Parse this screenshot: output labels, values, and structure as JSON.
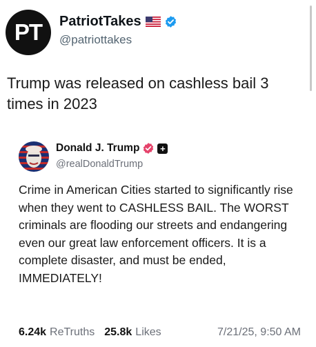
{
  "post": {
    "avatar_text": "PT",
    "display_name": "PatriotTakes",
    "handle": "@patriottakes",
    "text": "Trump was released on cashless bail 3 times in 2023"
  },
  "quote": {
    "display_name": "Donald J. Trump",
    "handle": "@realDonaldTrump",
    "text": "Crime in American Cities started to significantly rise when they went to CASHLESS BAIL. The WORST criminals are flooding our streets and endangering even our great law enforcement officers. It is a complete disaster, and must be ended, IMMEDIATELY!",
    "plus_badge": "+",
    "retruths_count": "6.24k",
    "retruths_label": "ReTruths",
    "likes_count": "25.8k",
    "likes_label": "Likes",
    "timestamp": "7/21/25, 9:50 AM"
  },
  "colors": {
    "verified_blue": "#1d9bf0",
    "truth_badge_pink": "#e5436b",
    "secondary_text": "#536471"
  },
  "icons": [
    "us-flag-icon",
    "verified-badge-icon",
    "pink-verified-badge-icon",
    "plus-badge-icon"
  ]
}
